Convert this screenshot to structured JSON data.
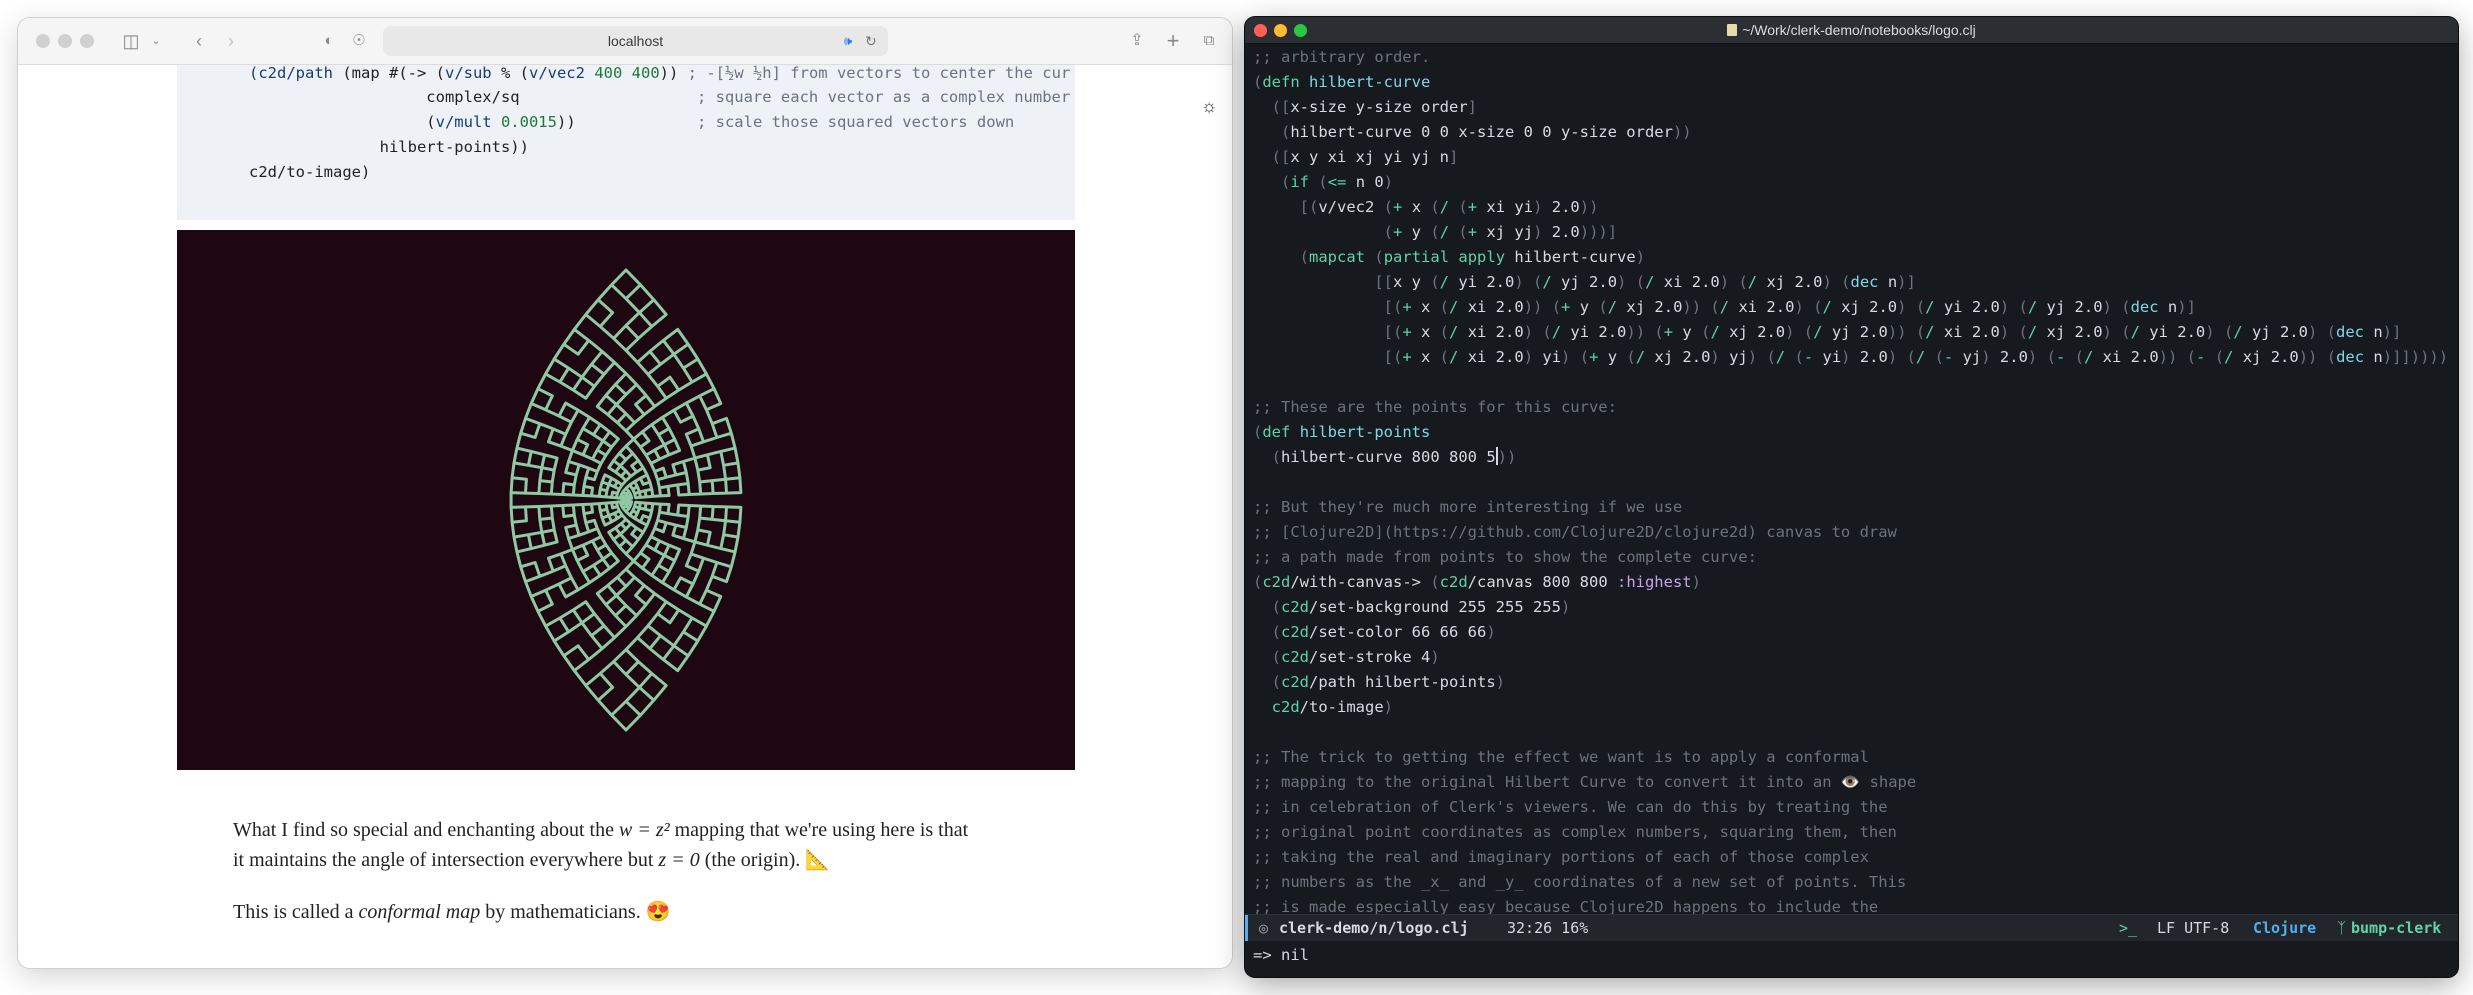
{
  "browser": {
    "url": "localhost",
    "code_lines": [
      {
        "t": "(c2d/path (map #(-> (v/sub % (v/vec2 400 400)) ; -[₄w ₄h] from vectors to center the cur"
      },
      {
        "t": "                   complex/sq                   ; square each vector as a complex number"
      },
      {
        "t": "                   (v/mult 0.0015))             ; scale those squared vectors down"
      },
      {
        "t": "              hilbert-points))"
      },
      {
        "t": "c2d/to-image)"
      }
    ],
    "prose1_a": "What I find so special and enchanting about the ",
    "prose1_math": "w = z²",
    "prose1_b": " mapping that we're using here is that",
    "prose2_a": "it maintains the angle of intersection everywhere but ",
    "prose2_math": "z = 0",
    "prose2_b": " (the origin). 📐",
    "prose3_a": "This is called a ",
    "prose3_em": "conformal map",
    "prose3_b": " by mathematicians. 😍",
    "colors": {
      "viz_bg": "#1f0712",
      "curve": "#8fc9a3"
    }
  },
  "editor": {
    "title": "~/Work/clerk-demo/notebooks/logo.clj",
    "modeline": {
      "buffer": "clerk-demo/n/logo.clj",
      "position": "32:26 16%",
      "encoding": "LF UTF-8",
      "mode": "Clojure",
      "branch": "bump-clerk"
    },
    "echo": "=> nil"
  }
}
